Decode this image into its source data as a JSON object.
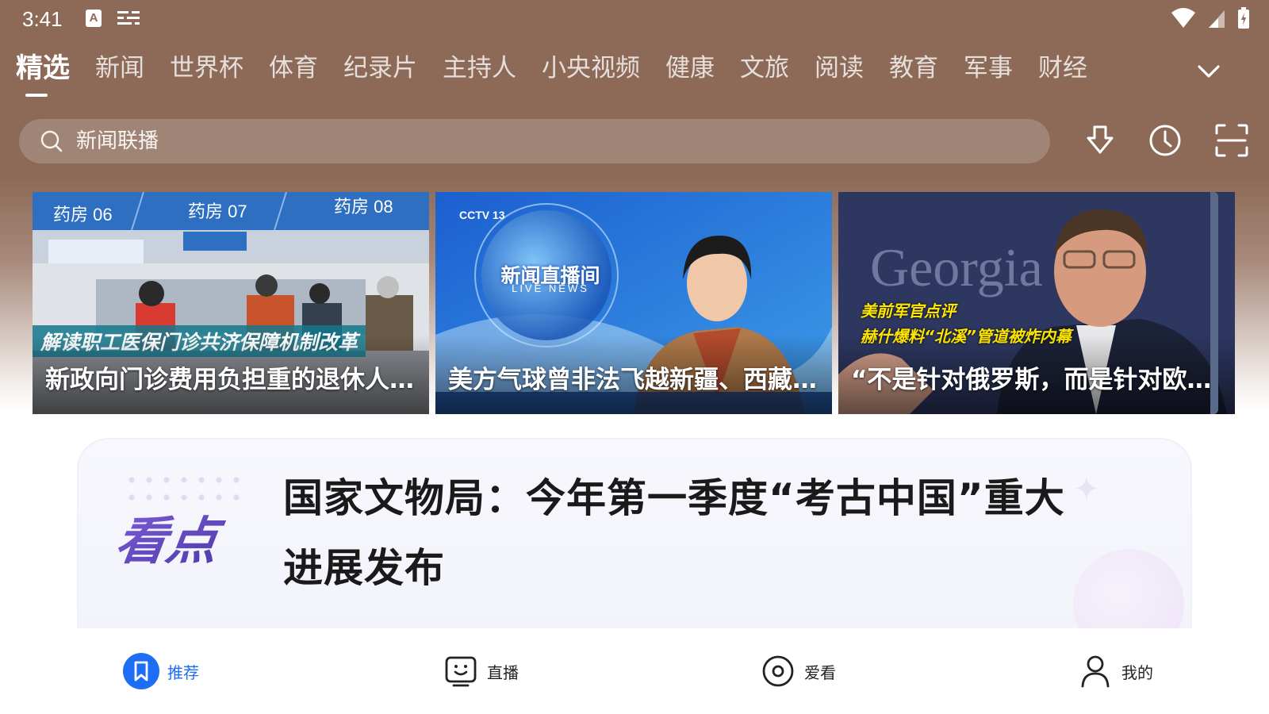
{
  "status_bar": {
    "time": "3:41"
  },
  "tabs": [
    {
      "label": "精选",
      "active": true
    },
    {
      "label": "新闻"
    },
    {
      "label": "世界杯"
    },
    {
      "label": "体育"
    },
    {
      "label": "纪录片"
    },
    {
      "label": "主持人"
    },
    {
      "label": "小央视频"
    },
    {
      "label": "健康"
    },
    {
      "label": "文旅"
    },
    {
      "label": "阅读"
    },
    {
      "label": "教育"
    },
    {
      "label": "军事"
    },
    {
      "label": "财经"
    }
  ],
  "search": {
    "placeholder": "新闻联播"
  },
  "cards": [
    {
      "title": "新政向门诊费用负担重的退休人员倾斜",
      "caption": "解读职工医保门诊共济保障机制改革"
    },
    {
      "title": "美方气球曾非法飞越新疆、西藏等地",
      "logo": "新闻直播间",
      "logo_sub": "LIVE NEWS"
    },
    {
      "title": "“不是针对俄罗斯，而是针对欧洲”",
      "caption_line1": "美前军官点评",
      "caption_line2": "赫什爆料“北溪”管道被炸内幕"
    }
  ],
  "highlight": {
    "logo_text": "看点",
    "headline": "国家文物局：今年第一季度“考古中国”重大进展发布"
  },
  "bottom_nav": [
    {
      "label": "推荐",
      "icon": "bookmark-icon",
      "active": true
    },
    {
      "label": "直播",
      "icon": "tv-smile-icon"
    },
    {
      "label": "爱看",
      "icon": "record-icon"
    },
    {
      "label": "我的",
      "icon": "user-icon"
    }
  ],
  "colors": {
    "header_brown": "#8c6a57",
    "accent_blue": "#1d6ef5",
    "logo_purple": "#6b4fc8"
  }
}
